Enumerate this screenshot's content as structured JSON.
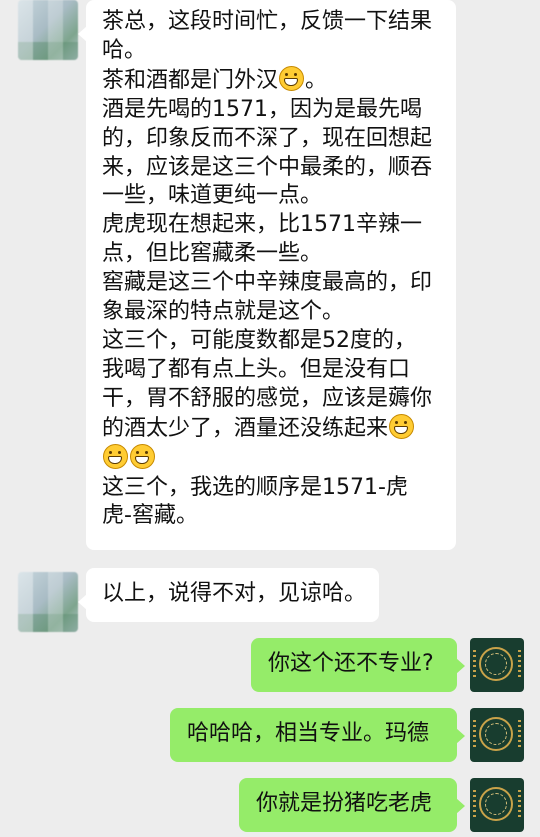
{
  "messages": [
    {
      "side": "left",
      "lines": [
        "茶总，这段时间忙，反馈一下结果",
        "哈。",
        "茶和酒都是门外汉",
        "酒是先喝的1571，因为是最先喝",
        "的，印象反而不深了，现在回想起",
        "来，应该是这三个中最柔的，顺吞",
        "一些，味道更纯一点。",
        "虎虎现在想起来，比1571辛辣一",
        "点，但比窖藏柔一些。",
        "窖藏是这三个中辛辣度最高的，印",
        "象最深的特点就是这个。",
        "这三个，可能度数都是52度的，",
        "我喝了都有点上头。但是没有口",
        "干，胃不舒服的感觉，应该是薅你",
        "的酒太少了，酒量还没练起来",
        "",
        "这三个，我选的顺序是1571-虎",
        "虎-窖藏。"
      ]
    },
    {
      "side": "left",
      "text": "以上，说得不对，见谅哈。"
    },
    {
      "side": "right",
      "text": "你这个还不专业?"
    },
    {
      "side": "right",
      "text": "哈哈哈，相当专业。玛德"
    },
    {
      "side": "right",
      "text": "你就是扮猪吃老虎"
    }
  ],
  "emoji": {
    "name": "grin-emoji"
  },
  "colors": {
    "background": "#ededed",
    "bubble_left": "#ffffff",
    "bubble_right": "#95ec69"
  }
}
